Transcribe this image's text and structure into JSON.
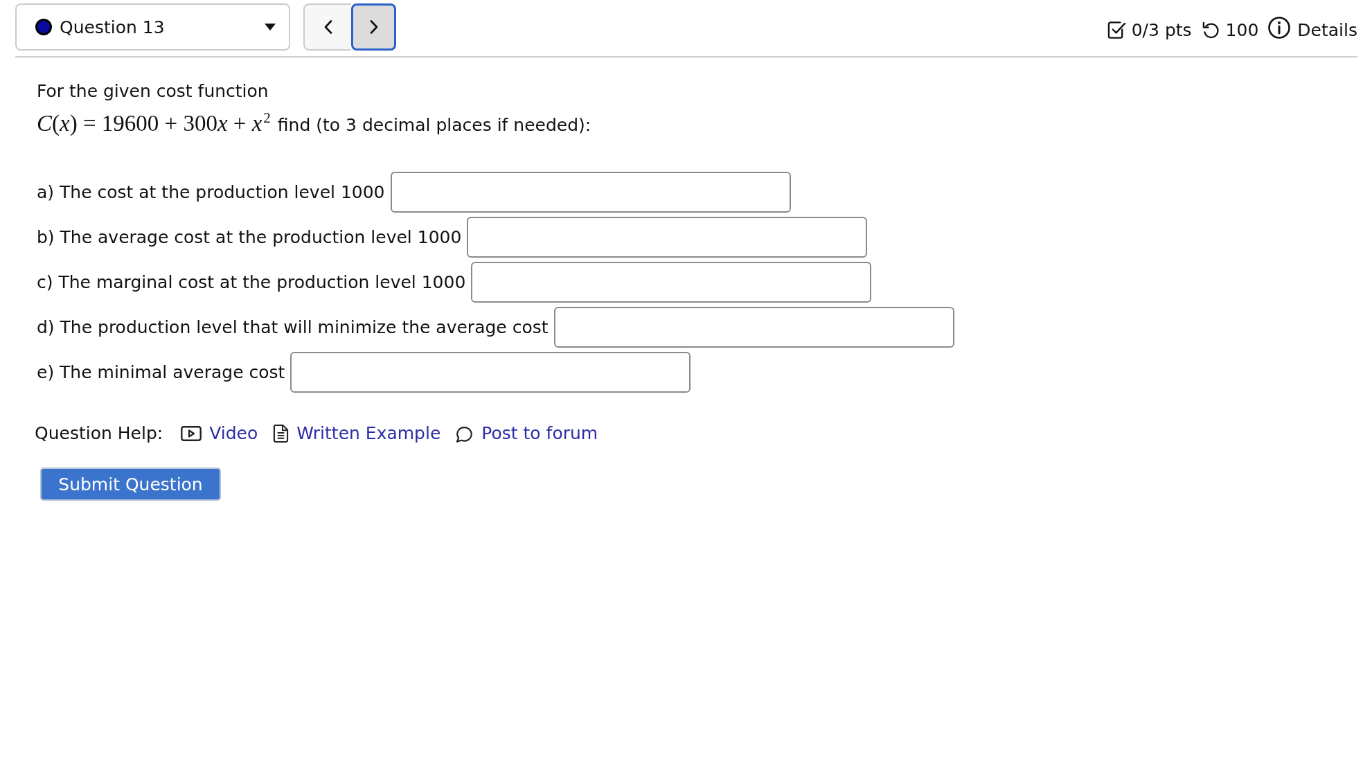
{
  "question_selector": {
    "label": "Question 13",
    "color": "#0a0aa0"
  },
  "nav_buttons": [
    {
      "kind": "prev",
      "selected": false
    },
    {
      "kind": "next",
      "selected": true
    }
  ],
  "score_bar": [
    {
      "kind": "score",
      "text": "0/3 pts"
    },
    {
      "kind": "attempts",
      "text": "100"
    },
    {
      "kind": "details",
      "text": "Details"
    }
  ],
  "question": {
    "intro": "For the given cost function",
    "formula": [
      {
        "kind": "var",
        "text": "C"
      },
      {
        "kind": "sym",
        "text": "("
      },
      {
        "kind": "var",
        "text": "x"
      },
      {
        "kind": "sym",
        "text": ")"
      },
      {
        "kind": "op",
        "text": "="
      },
      {
        "kind": "num",
        "text": "19600"
      },
      {
        "kind": "op",
        "text": "+"
      },
      {
        "kind": "num",
        "text": "300"
      },
      {
        "kind": "var",
        "text": "x"
      },
      {
        "kind": "op",
        "text": "+"
      },
      {
        "kind": "var",
        "text": "x"
      },
      {
        "kind": "sup",
        "text": "2"
      }
    ],
    "instruction": "find (to 3 decimal places if needed):"
  },
  "parts": [
    {
      "label": "a) The cost at the production level 1000"
    },
    {
      "label": "b) The average cost at the production level 1000"
    },
    {
      "label": "c) The marginal cost at the production level 1000"
    },
    {
      "label": "d) The production level that will minimize the average cost"
    },
    {
      "label": "e) The minimal average cost"
    }
  ],
  "question_help": {
    "label": "Question Help:",
    "links": [
      {
        "kind": "video",
        "text": "Video"
      },
      {
        "kind": "document",
        "text": "Written Example"
      },
      {
        "kind": "forum",
        "text": "Post to forum"
      }
    ]
  },
  "submit_button": "Submit Question"
}
